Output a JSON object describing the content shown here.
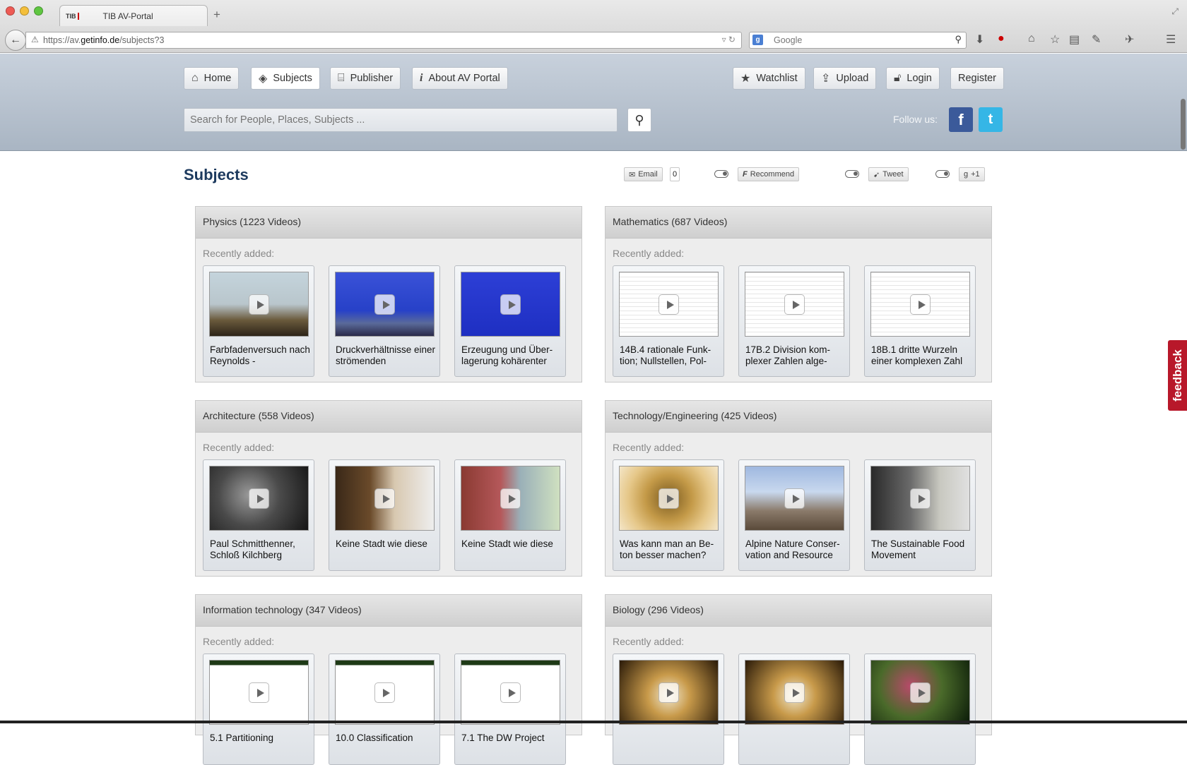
{
  "browser": {
    "tab_title": "TIB AV-Portal",
    "tab_favicon": "TIB",
    "url_prefix": "https://av.",
    "url_host": "getinfo.de",
    "url_path": "/subjects?3",
    "search_engine": "Google"
  },
  "header": {
    "nav": [
      {
        "label": "Home",
        "icon": "home-icon"
      },
      {
        "label": "Subjects",
        "icon": "tag-icon"
      },
      {
        "label": "Publisher",
        "icon": "building-icon"
      },
      {
        "label": "About AV Portal",
        "icon": "info-icon"
      }
    ],
    "user_nav": [
      {
        "label": "Watchlist",
        "icon": "star-icon"
      },
      {
        "label": "Upload",
        "icon": "upload-icon"
      },
      {
        "label": "Login",
        "icon": "lock-icon"
      },
      {
        "label": "Register",
        "icon": ""
      }
    ],
    "search_placeholder": "Search for People, Places, Subjects ...",
    "follow_label": "Follow us:"
  },
  "main": {
    "title": "Subjects",
    "share": {
      "email_label": "Email",
      "email_count": "0",
      "recommend_label": "Recommend",
      "tweet_label": "Tweet",
      "plus_label": "+1"
    },
    "recent_label": "Recently added:",
    "subjects": [
      {
        "heading": "Physics (1223 Videos)",
        "videos": [
          {
            "title": "Farbfadenversuch nach Reynolds -",
            "thumb": "lab-apparatus"
          },
          {
            "title": "Druckverhältnisse einer strömenden",
            "thumb": "blue-slide"
          },
          {
            "title": "Erzeugung und Über-lagerung kohärenter",
            "thumb": "blue-slide-text"
          }
        ]
      },
      {
        "heading": "Mathematics (687 Videos)",
        "videos": [
          {
            "title": "14B.4 rationale Funk-tion; Nullstellen, Pol-",
            "thumb": "handwriting"
          },
          {
            "title": "17B.2 Division kom-plexer Zahlen alge-",
            "thumb": "handwriting"
          },
          {
            "title": "18B.1 dritte Wurzeln einer komplexen Zahl",
            "thumb": "handwriting"
          }
        ]
      },
      {
        "heading": "Architecture (558 Videos)",
        "videos": [
          {
            "title": "Paul Schmitthenner, Schloß Kilchberg",
            "thumb": "bw-photo"
          },
          {
            "title": "Keine Stadt wie diese",
            "thumb": "interview"
          },
          {
            "title": "Keine Stadt wie diese",
            "thumb": "street"
          }
        ]
      },
      {
        "heading": "Technology/Engineering (425 Videos)",
        "videos": [
          {
            "title": "Was kann man an Be-ton besser machen?",
            "thumb": "concrete"
          },
          {
            "title": "Alpine Nature Conser-vation and Resource",
            "thumb": "village"
          },
          {
            "title": "The Sustainable Food Movement",
            "thumb": "shopfront"
          }
        ]
      },
      {
        "heading": "Information technology (347 Videos)",
        "videos": [
          {
            "title": "5.1 Partitioning",
            "thumb": "slide"
          },
          {
            "title": "10.0 Classification",
            "thumb": "slide"
          },
          {
            "title": "7.1 The DW Project",
            "thumb": "slide"
          }
        ]
      },
      {
        "heading": "Biology (296 Videos)",
        "videos": [
          {
            "title": "",
            "thumb": "bees"
          },
          {
            "title": "",
            "thumb": "bees"
          },
          {
            "title": "",
            "thumb": "flowers"
          }
        ]
      }
    ]
  },
  "feedback_label": "feedback"
}
